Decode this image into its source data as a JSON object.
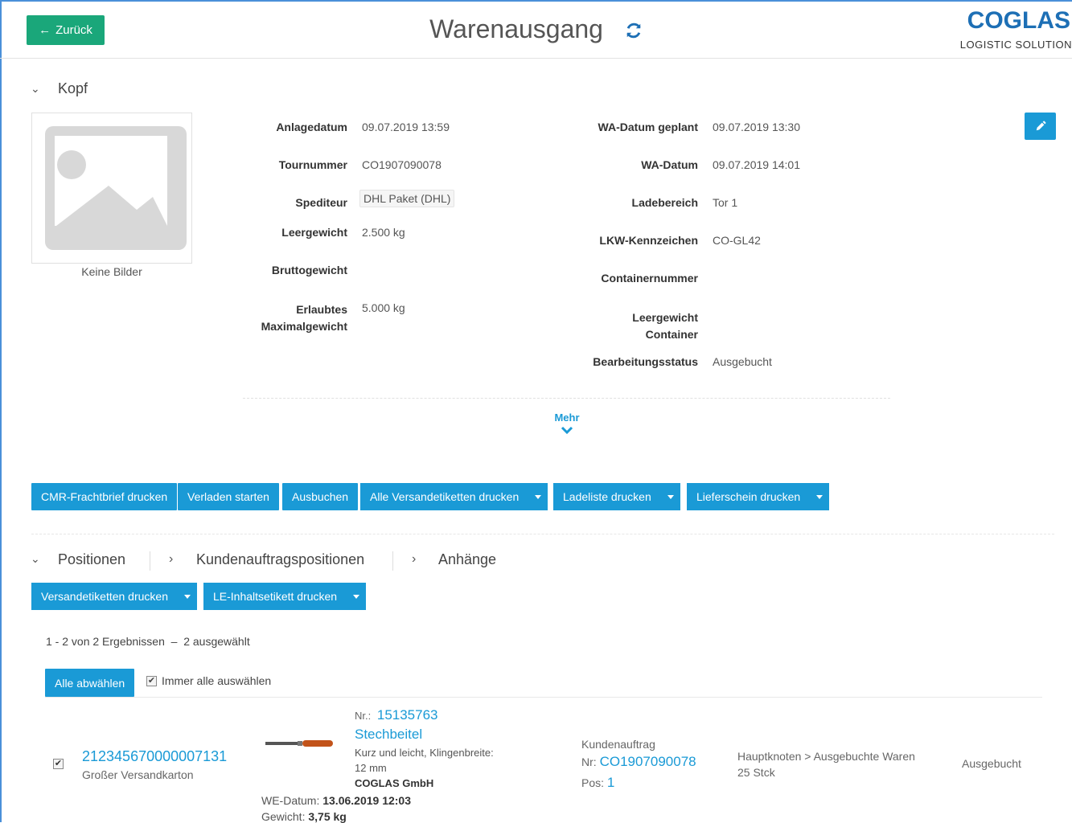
{
  "header": {
    "back_label": "Zurück",
    "title": "Warenausgang",
    "logo_main": "COGLAS",
    "logo_sub": "LOGISTIC SOLUTION"
  },
  "kopf": {
    "title": "Kopf",
    "image_caption": "Keine Bilder",
    "fields_left": [
      {
        "label": "Anlagedatum",
        "value": "09.07.2019 13:59"
      },
      {
        "label": "Tournummer",
        "value": "CO1907090078"
      },
      {
        "label": "Spediteur",
        "value": "DHL Paket (DHL)"
      },
      {
        "label": "Leergewicht",
        "value": "2.500 kg"
      },
      {
        "label": "Bruttogewicht",
        "value": ""
      },
      {
        "label": "Erlaubtes Maximalgewicht",
        "label_l1": "Erlaubtes",
        "label_l2": "Maximalgewicht",
        "value": "5.000 kg"
      }
    ],
    "fields_right": [
      {
        "label": "WA-Datum geplant",
        "value": "09.07.2019 13:30"
      },
      {
        "label": "WA-Datum",
        "value": "09.07.2019 14:01"
      },
      {
        "label": "Ladebereich",
        "value": "Tor 1"
      },
      {
        "label": "LKW-Kennzeichen",
        "value": "CO-GL42"
      },
      {
        "label": "Containernummer",
        "value": ""
      },
      {
        "label": "Leergewicht Container",
        "label_l1": "Leergewicht",
        "label_l2": "Container",
        "value": ""
      },
      {
        "label": "Bearbeitungsstatus",
        "value": "Ausgebucht"
      }
    ],
    "mehr_label": "Mehr"
  },
  "actions": {
    "cmr": "CMR-Frachtbrief drucken",
    "verladen": "Verladen starten",
    "ausbuchen": "Ausbuchen",
    "versandetiketten_alle": "Alle Versandetiketten drucken",
    "ladeliste": "Ladeliste drucken",
    "lieferschein": "Lieferschein drucken"
  },
  "tabs": {
    "positionen": "Positionen",
    "kundenauftragspositionen": "Kundenauftragspositionen",
    "anhaenge": "Anhänge"
  },
  "positionen": {
    "btn_versandetiketten": "Versandetiketten drucken",
    "btn_le_inhalt": "LE-Inhaltsetikett drucken",
    "result_text": "1 - 2 von 2 Ergebnissen  –  2 ausgewählt",
    "btn_alle_abwaehlen": "Alle abwählen",
    "immer_alle_label": "Immer alle auswählen",
    "rows": [
      {
        "le_nr": "212345670000007131",
        "le_typ": "Großer Versandkarton",
        "artikel_nr_label": "Nr.:",
        "artikel_nr": "15135763",
        "artikel_name": "Stechbeitel",
        "artikel_desc_l1": "Kurz und leicht, Klingenbreite:",
        "artikel_desc_l2": "12 mm",
        "hersteller": "COGLAS GmbH",
        "we_datum_label": "WE-Datum:",
        "we_datum": "13.06.2019 12:03",
        "gewicht_label": "Gewicht:",
        "gewicht": "3,75 kg",
        "ka_label": "Kundenauftrag",
        "ka_nr_label": "Nr:",
        "ka_nr": "CO1907090078",
        "ka_pos_label": "Pos:",
        "ka_pos": "1",
        "lagerort": "Hauptknoten > Ausgebuchte Waren",
        "menge": "25 Stck",
        "status": "Ausgebucht"
      }
    ]
  }
}
